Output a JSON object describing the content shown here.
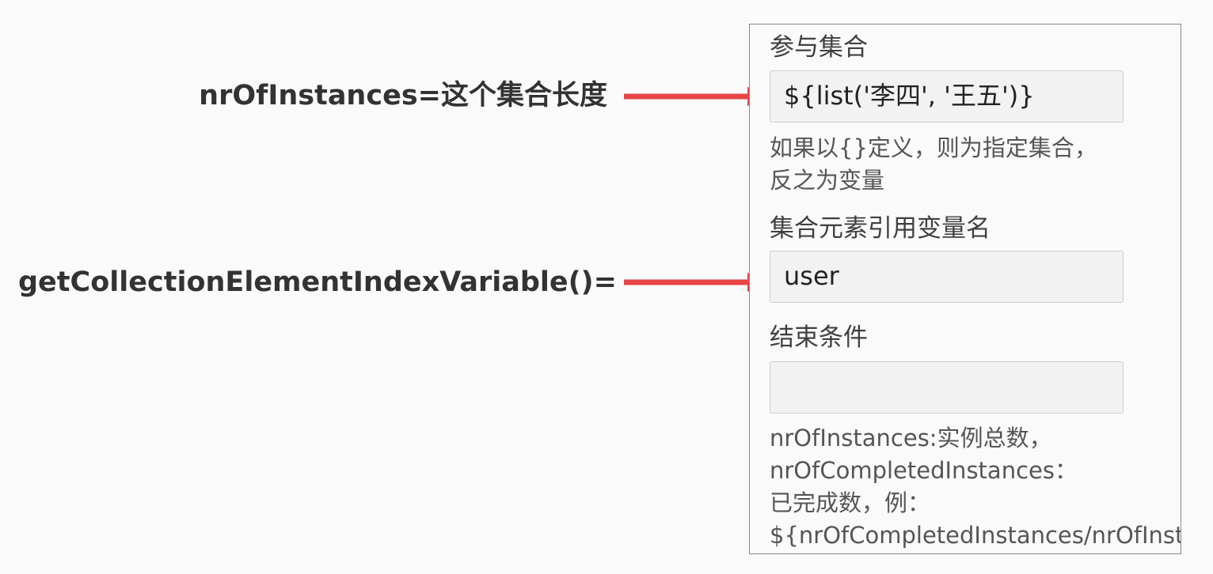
{
  "annotations": {
    "collection_note": "nrOfInstances=这个集合长度",
    "element_variable_note": "getCollectionElementIndexVariable()="
  },
  "colors": {
    "arrow": "#e84545",
    "panel_border": "#8a8a8a",
    "input_background": "#f2f2f2"
  },
  "panel": {
    "collection": {
      "label": "参与集合",
      "value": "${list('李四', '王五')}",
      "hint_line1": "如果以{}定义，则为指定集合，",
      "hint_line2": "反之为变量"
    },
    "element_variable": {
      "label": "集合元素引用变量名",
      "value": "user"
    },
    "completion_condition": {
      "label": "结束条件",
      "value": "",
      "hint_line1": "nrOfInstances:实例总数，",
      "hint_line2": "nrOfCompletedInstances：",
      "hint_line3": "已完成数，例：",
      "hint_line4": "${nrOfCompletedInstances/nrOfInstances"
    }
  }
}
